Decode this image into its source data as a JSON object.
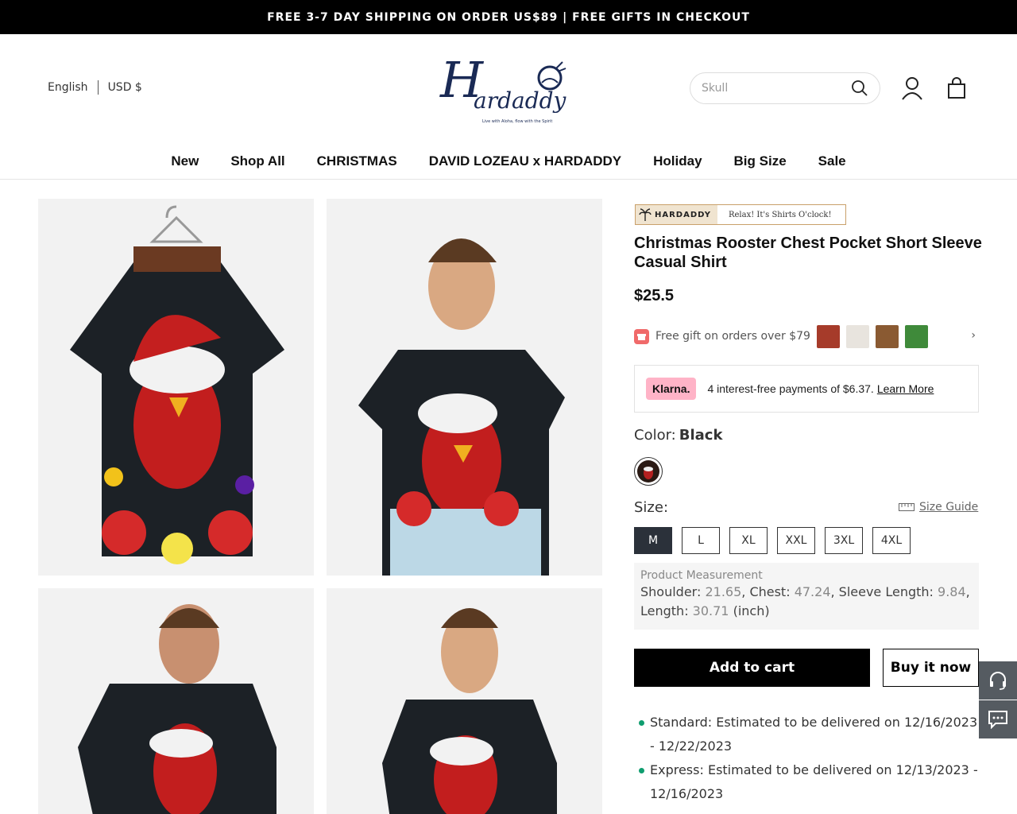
{
  "announcement": "FREE 3-7 DAY SHIPPING ON ORDER US$89 | FREE GIFTS IN CHECKOUT",
  "header": {
    "language": "English",
    "currency": "USD $",
    "logo_text": "Hardaddy",
    "logo_tagline": "Live with Aloha, flow with the Spirit",
    "search_placeholder": "Skull"
  },
  "nav": [
    "New",
    "Shop All",
    "CHRISTMAS",
    "DAVID LOZEAU x HARDADDY",
    "Holiday",
    "Big Size",
    "Sale"
  ],
  "product": {
    "brand_badge": "HARDADDY",
    "brand_slogan": "Relax! It's Shirts O'clock!",
    "title": "Christmas Rooster Chest Pocket Short Sleeve Casual Shirt",
    "price": "$25.5",
    "gift_text": "Free gift on orders over $79",
    "klarna_logo": "Klarna.",
    "klarna_text": "4 interest-free payments of $6.37.",
    "klarna_link": "Learn More",
    "color_label": "Color:",
    "color_value": "Black",
    "size_label": "Size:",
    "size_guide": "Size Guide",
    "sizes": [
      "M",
      "L",
      "XL",
      "XXL",
      "3XL",
      "4XL"
    ],
    "selected_size": "M",
    "measurement": {
      "heading": "Product Measurement",
      "shoulder_label": "Shoulder:",
      "shoulder": "21.65",
      "chest_label": "Chest:",
      "chest": "47.24",
      "sleeve_label": "Sleeve Length:",
      "sleeve": "9.84",
      "length_label": "Length:",
      "length": "30.71",
      "unit": "(inch)"
    },
    "add_to_cart": "Add to cart",
    "buy_now": "Buy it now",
    "shipping": [
      "Standard: Estimated to be delivered on 12/16/2023 - 12/22/2023",
      "Express: Estimated to be delivered on 12/13/2023 - 12/16/2023"
    ]
  },
  "colors": {
    "accent": "#000000",
    "klarna_pink": "#ffb3c7",
    "ship_dot": "#0f9d6f",
    "side_buttons": "#555b61"
  }
}
